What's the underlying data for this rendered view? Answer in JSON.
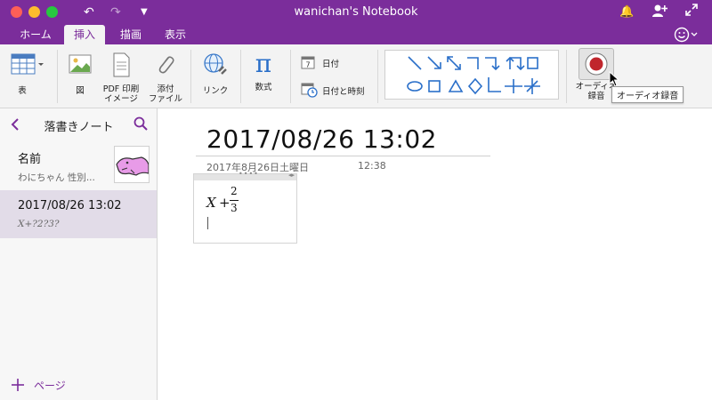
{
  "window": {
    "title": "wanichan's Notebook",
    "colors": {
      "accent": "#7B2D9B",
      "close": "#fe5f57",
      "minimize": "#febc2e",
      "zoom": "#28c840"
    }
  },
  "tabs": [
    {
      "label": "ホーム"
    },
    {
      "label": "挿入"
    },
    {
      "label": "描画"
    },
    {
      "label": "表示"
    }
  ],
  "ribbon": {
    "table": "表",
    "picture": "図",
    "pdf_line1": "PDF 印刷",
    "pdf_line2": "イメージ",
    "attach_line1": "添付",
    "attach_line2": "ファイル",
    "link": "リンク",
    "equation": "数式",
    "date": "日付",
    "datetime": "日付と時刻",
    "audio_line1": "オーディオ",
    "audio_line2": "録音",
    "tooltip": "オーディオ録音"
  },
  "sidebar": {
    "title": "落書きノート",
    "pages": [
      {
        "title": "名前",
        "preview": "わにちゃん 性別..."
      },
      {
        "title": "2017/08/26 13:02",
        "preview": "X+?2?3?"
      }
    ],
    "add_page": "ページ"
  },
  "note": {
    "title": "2017/08/26 13:02",
    "date": "2017年8月26日土曜日",
    "time": "12:38",
    "math_var": "X",
    "math_plus": "+",
    "math_num": "2",
    "math_den": "3"
  }
}
